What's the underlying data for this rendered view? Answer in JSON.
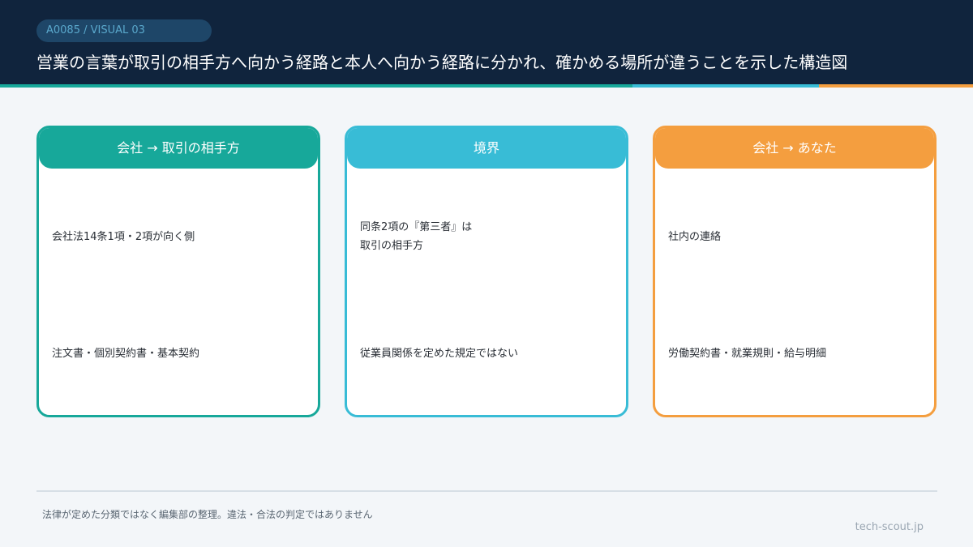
{
  "header": {
    "tag": "A0085 / VISUAL 03",
    "title": "営業の言葉が取引の相手方へ向かう経路と本人へ向かう経路に分かれ、確かめる場所が違うことを示した構造図"
  },
  "colors": {
    "header_bg": "#10243d",
    "teal": "#17a89a",
    "cyan": "#38bcd6",
    "orange": "#f49e3f"
  },
  "panels": [
    {
      "header": "会社 → 取引の相手方",
      "upper_lines": [
        "会社法14条1項・2項が向く側"
      ],
      "lower": "注文書・個別契約書・基本契約"
    },
    {
      "header": "境界",
      "upper_lines": [
        "同条2項の『第三者』は",
        "取引の相手方"
      ],
      "lower": "従業員関係を定めた規定ではない"
    },
    {
      "header": "会社 → あなた",
      "upper_lines": [
        "社内の連絡"
      ],
      "lower": "労働契約書・就業規則・給与明細"
    }
  ],
  "footer": {
    "note": "法律が定めた分類ではなく編集部の整理。違法・合法の判定ではありません",
    "site": "tech-scout.jp"
  }
}
